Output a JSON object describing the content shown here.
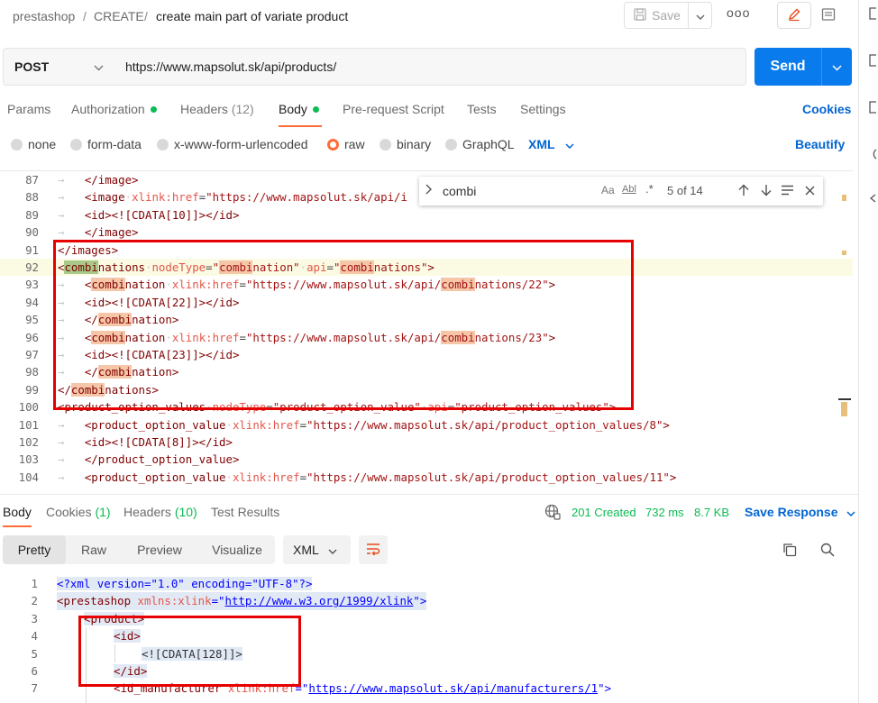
{
  "breadcrumb": {
    "root": "prestashop",
    "sep1": "/",
    "folder": "CREATE",
    "sep2": "/",
    "request": "create main part of variate product"
  },
  "toolbar": {
    "save_label": "Save",
    "more_label": "ooo"
  },
  "request": {
    "method": "POST",
    "url": "https://www.mapsolut.sk/api/products/",
    "send_label": "Send"
  },
  "request_tabs": [
    {
      "label": "Params"
    },
    {
      "label": "Authorization",
      "dot": true
    },
    {
      "label": "Headers",
      "count": "(12)"
    },
    {
      "label": "Body",
      "dot": true,
      "active": true
    },
    {
      "label": "Pre-request Script"
    },
    {
      "label": "Tests"
    },
    {
      "label": "Settings"
    }
  ],
  "cookies_label": "Cookies",
  "body_types": [
    {
      "label": "none"
    },
    {
      "label": "form-data"
    },
    {
      "label": "x-www-form-urlencoded"
    },
    {
      "label": "raw",
      "selected": true
    },
    {
      "label": "binary"
    },
    {
      "label": "GraphQL"
    }
  ],
  "body_format": "XML",
  "beautify_label": "Beautify",
  "find": {
    "query": "combi",
    "case_label": "Aa",
    "word_label": "Abl",
    "regex_label": ".*",
    "result": "5 of 14"
  },
  "editor": {
    "lines": [
      {
        "n": "87",
        "text": "    </image>"
      },
      {
        "n": "88",
        "text": "    <image xlink:href=\"https://www.mapsolut.sk/api/i"
      },
      {
        "n": "89",
        "text": "    <id><![CDATA[10]]></id>"
      },
      {
        "n": "90",
        "text": "    </image>"
      },
      {
        "n": "91",
        "text": "</images>"
      },
      {
        "n": "92",
        "text": "<combinations nodeType=\"combination\" api=\"combinations\">"
      },
      {
        "n": "93",
        "text": "    <combination xlink:href=\"https://www.mapsolut.sk/api/combinations/22\">"
      },
      {
        "n": "94",
        "text": "    <id><![CDATA[22]]></id>"
      },
      {
        "n": "95",
        "text": "    </combination>"
      },
      {
        "n": "96",
        "text": "    <combination xlink:href=\"https://www.mapsolut.sk/api/combinations/23\">"
      },
      {
        "n": "97",
        "text": "    <id><![CDATA[23]]></id>"
      },
      {
        "n": "98",
        "text": "    </combination>"
      },
      {
        "n": "99",
        "text": "</combinations>"
      },
      {
        "n": "100",
        "text": "<product_option_values nodeType=\"product_option_value\" api=\"product_option_values\">"
      },
      {
        "n": "101",
        "text": "    <product_option_value xlink:href=\"https://www.mapsolut.sk/api/product_option_values/8\">"
      },
      {
        "n": "102",
        "text": "    <id><![CDATA[8]]></id>"
      },
      {
        "n": "103",
        "text": "    </product_option_value>"
      },
      {
        "n": "104",
        "text": "    <product_option_value xlink:href=\"https://www.mapsolut.sk/api/product_option_values/11\">"
      }
    ]
  },
  "response_tabs": [
    {
      "label": "Body",
      "active": true
    },
    {
      "label": "Cookies",
      "count": "(1)"
    },
    {
      "label": "Headers",
      "count": "(10)"
    },
    {
      "label": "Test Results"
    }
  ],
  "response_meta": {
    "status": "201 Created",
    "time": "732 ms",
    "size": "8.7 KB",
    "save_response_label": "Save Response"
  },
  "view_modes": [
    "Pretty",
    "Raw",
    "Preview",
    "Visualize"
  ],
  "response_format": "XML",
  "response": {
    "lines": [
      {
        "n": "1"
      },
      {
        "n": "2"
      },
      {
        "n": "3",
        "text": "<product>"
      },
      {
        "n": "4",
        "text": "<id>"
      },
      {
        "n": "5",
        "text": "<![CDATA[128]]>"
      },
      {
        "n": "6",
        "text": "</id>"
      },
      {
        "n": "7"
      }
    ],
    "xml_decl": "<?xml version=\"1.0\" encoding=\"UTF-8\"?>",
    "root_open": "<prestashop ",
    "root_attr": "xmlns:xlink",
    "root_eq": "=\"",
    "root_link": "http://www.w3.org/1999/xlink",
    "root_close": "\">",
    "line7_tag": "<id_manufacturer ",
    "line7_attr": "xlink:href",
    "line7_eq": "=\"",
    "line7_link": "https://www.mapsolut.sk/api/manufacturers/1",
    "line7_close": "\">"
  },
  "colors": {
    "accent": "#ff6c37",
    "send": "#097bed",
    "link": "#0265d2",
    "success": "#0cbb52",
    "annotation": "#e60000"
  }
}
